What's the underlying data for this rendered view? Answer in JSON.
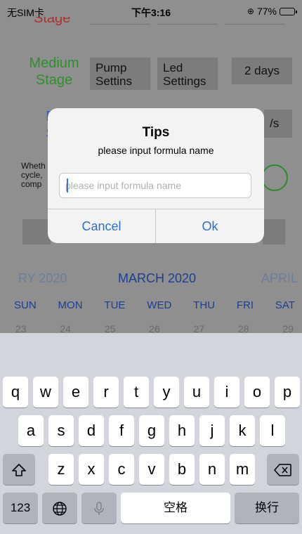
{
  "status_bar": {
    "carrier": "无SIM卡",
    "time": "下午3:16",
    "battery_percent": "77%",
    "battery_level": 0.77
  },
  "background": {
    "top_stage_label_partial": "Stage",
    "medium_stage": {
      "label_line1": "Medium",
      "label_line2": "Stage",
      "label_color": "#2f8f2f",
      "pump_button_line1": "Pump",
      "pump_button_line2": "Settins",
      "led_button_line1": "Led",
      "led_button_line2": "Settings",
      "days_button": "2 days"
    },
    "ripe_stage": {
      "label_line1": "Ri",
      "label_line2": "St",
      "label_color": "#2b63c6",
      "days_button_partial": "/s"
    },
    "note_text": "Wheth cycle, comp",
    "top_stage_color": "#d22d2d"
  },
  "calendar": {
    "prev_month": "RY 2020",
    "current_month": "MARCH 2020",
    "next_month": "APRIL",
    "weekdays": [
      "SUN",
      "MON",
      "TUE",
      "WED",
      "THU",
      "FRI",
      "SAT"
    ],
    "dates": [
      "23",
      "24",
      "25",
      "26",
      "27",
      "28",
      "29"
    ]
  },
  "dialog": {
    "title": "Tips",
    "message": "please input formula name",
    "input_placeholder": "please input formula name",
    "input_value": "",
    "cancel_label": "Cancel",
    "ok_label": "Ok",
    "accent_color": "#2b6fd6"
  },
  "keyboard": {
    "row1": [
      "q",
      "w",
      "e",
      "r",
      "t",
      "y",
      "u",
      "i",
      "o",
      "p"
    ],
    "row2": [
      "a",
      "s",
      "d",
      "f",
      "g",
      "h",
      "j",
      "k",
      "l"
    ],
    "row3": [
      "z",
      "x",
      "c",
      "v",
      "b",
      "n",
      "m"
    ],
    "shift_icon": "shift-arrow-icon",
    "backspace_icon": "backspace-icon",
    "numbers_label": "123",
    "globe_icon": "globe-icon",
    "mic_icon": "microphone-icon",
    "space_label": "空格",
    "return_label": "换行"
  }
}
